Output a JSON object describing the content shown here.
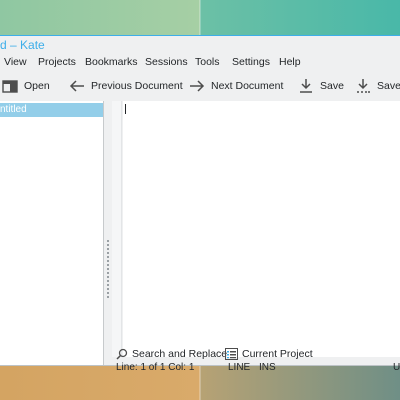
{
  "window": {
    "title": "d – Kate"
  },
  "menu": [
    {
      "label": "View"
    },
    {
      "label": "Projects"
    },
    {
      "label": "Bookmarks"
    },
    {
      "label": "Sessions"
    },
    {
      "label": "Tools"
    },
    {
      "label": "Settings"
    },
    {
      "label": "Help"
    }
  ],
  "toolbar": {
    "open_label": "Open",
    "previous_label": "Previous Document",
    "next_label": "Next Document",
    "save_label": "Save",
    "save_as_label": "Save"
  },
  "documents": [
    {
      "name": "ntitled"
    }
  ],
  "status": {
    "position": "Line: 1 of 1 Col: 1",
    "mode_line": "LINE",
    "mode_ins": "INS",
    "encoding": "U"
  },
  "bottom": {
    "search_label": "Search and Replace",
    "project_label": "Current Project"
  },
  "colors": {
    "accent": "#3daee9",
    "selection": "#93cee9",
    "window_bg": "#eff0f1",
    "editor_bg": "#ffffff"
  },
  "icons": {
    "open": "document-open-icon",
    "previous": "arrow-left-icon",
    "next": "arrow-right-icon",
    "save": "download-save-icon",
    "save_as": "save-as-icon",
    "search": "search-icon",
    "project": "project-list-icon"
  }
}
